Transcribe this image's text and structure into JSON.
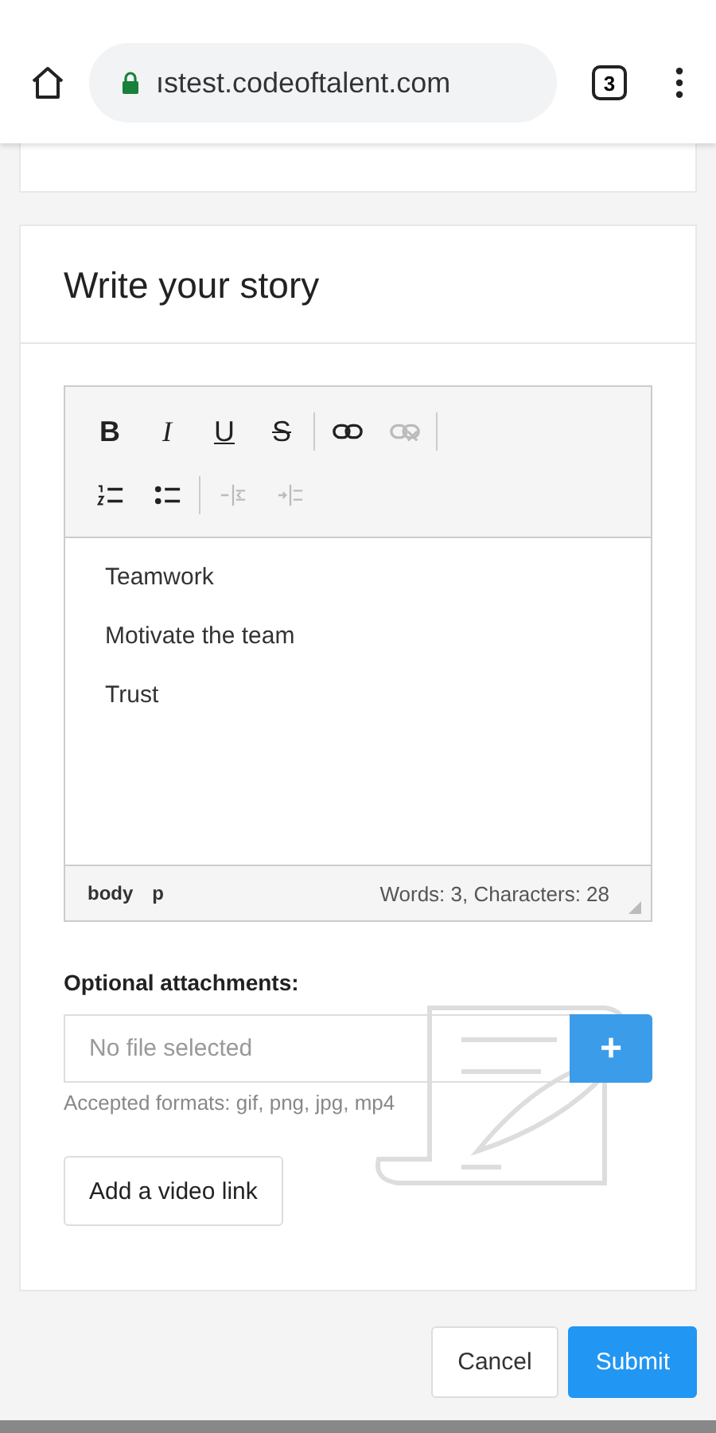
{
  "browser": {
    "url": "ıstest.codeoftalent.com",
    "secure": true,
    "tab_count": "3"
  },
  "card": {
    "title": "Write your story",
    "editor": {
      "toolbar": [
        [
          {
            "kind": "bold",
            "label": "B",
            "disabled": false
          },
          {
            "kind": "italic",
            "label": "I",
            "disabled": false
          },
          {
            "kind": "underline",
            "label": "U",
            "disabled": false
          },
          {
            "kind": "strike",
            "label": "S",
            "disabled": false
          },
          {
            "kind": "separator"
          },
          {
            "kind": "link",
            "disabled": false
          },
          {
            "kind": "unlink",
            "disabled": true
          },
          {
            "kind": "separator"
          }
        ],
        [
          {
            "kind": "ordered-list",
            "disabled": false
          },
          {
            "kind": "bullet-list",
            "disabled": false
          },
          {
            "kind": "separator"
          },
          {
            "kind": "outdent",
            "disabled": true
          },
          {
            "kind": "indent",
            "disabled": true
          }
        ]
      ],
      "paragraphs": [
        "Teamwork",
        "Motivate the team",
        "Trust"
      ],
      "path": [
        "body",
        "p"
      ],
      "count": "Words: 3, Characters: 28"
    },
    "attachments": {
      "label": "Optional attachments:",
      "placeholder": "No file selected",
      "add_button": "+",
      "hint": "Accepted formats: gif, png, jpg, mp4"
    },
    "video_button": "Add a video link"
  },
  "actions": [
    {
      "label": "Cancel",
      "primary": false
    },
    {
      "label": "Submit",
      "primary": true
    }
  ]
}
